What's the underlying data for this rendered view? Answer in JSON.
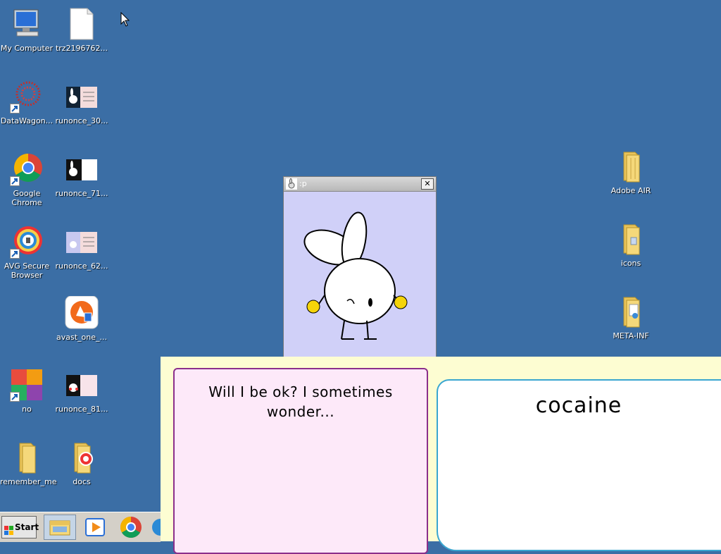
{
  "desktop": {
    "icons_left": [
      {
        "label": "My Computer",
        "icon": "computer-icon"
      },
      {
        "label": "trz2196762...",
        "icon": "file-icon"
      },
      {
        "label": "DataWagon...",
        "icon": "datawagon-icon"
      },
      {
        "label": "runonce_30...",
        "icon": "image-thumb-icon"
      },
      {
        "label": "Google Chrome",
        "icon": "chrome-icon"
      },
      {
        "label": "runonce_71...",
        "icon": "image-thumb-icon"
      },
      {
        "label": "AVG Secure Browser",
        "icon": "avg-browser-icon"
      },
      {
        "label": "runonce_62...",
        "icon": "image-thumb-icon"
      },
      {
        "label": "avast_one_...",
        "icon": "avast-icon"
      },
      {
        "label": "no",
        "icon": "avg-tiles-icon"
      },
      {
        "label": "runonce_81...",
        "icon": "image-thumb-icon"
      },
      {
        "label": "remember_me",
        "icon": "folder-icon"
      },
      {
        "label": "docs",
        "icon": "folder-icon"
      }
    ],
    "icons_right": [
      {
        "label": "Adobe AIR",
        "icon": "folder-icon"
      },
      {
        "label": "icons",
        "icon": "folder-icon"
      },
      {
        "label": "META-INF",
        "icon": "folder-icon"
      }
    ]
  },
  "popup": {
    "title": ":p",
    "close_label": "✕"
  },
  "overlay": {
    "message": "Will I be ok? I sometimes wonder...",
    "word": "cocaine"
  },
  "taskbar": {
    "start_label": "Start",
    "buttons": [
      "explorer-icon",
      "media-player-icon",
      "chrome-icon"
    ]
  },
  "colors": {
    "desktop_bg": "#3b6ea5",
    "popup_bg": "#d0d0f8",
    "overlay_bg": "#fdfdd2",
    "pink_card": "#fde9f9",
    "white_card_border": "#3aa6d0"
  }
}
